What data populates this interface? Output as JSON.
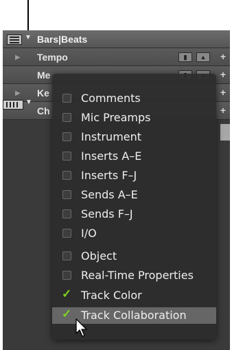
{
  "header": {
    "title": "Bars|Beats"
  },
  "rulers": [
    {
      "label": "Tempo",
      "expand": "▶"
    },
    {
      "label": "Me",
      "expand": ""
    },
    {
      "label": "Ke",
      "expand": "▶"
    },
    {
      "label": "Ch",
      "expand": ""
    }
  ],
  "menu_items": [
    {
      "label": "Comments",
      "checked": false
    },
    {
      "label": "Mic Preamps",
      "checked": false
    },
    {
      "label": "Instrument",
      "checked": false
    },
    {
      "label": "Inserts A–E",
      "checked": false
    },
    {
      "label": "Inserts F–J",
      "checked": false
    },
    {
      "label": "Sends A–E",
      "checked": false
    },
    {
      "label": "Sends F–J",
      "checked": false
    },
    {
      "label": "I/O",
      "checked": false
    },
    {
      "label": "Object",
      "checked": false
    },
    {
      "label": "Real-Time Properties",
      "checked": false
    },
    {
      "label": "Track Color",
      "checked": true
    },
    {
      "label": "Track Collaboration",
      "checked": true,
      "highlighted": true
    }
  ],
  "colors": {
    "check": "#7ed321",
    "highlight": "#666666",
    "menu_bg": "#2d2d2d"
  },
  "icons": {
    "callout": "arrow-down",
    "cursor": "mouse-pointer-arrow",
    "check": "checkmark"
  }
}
